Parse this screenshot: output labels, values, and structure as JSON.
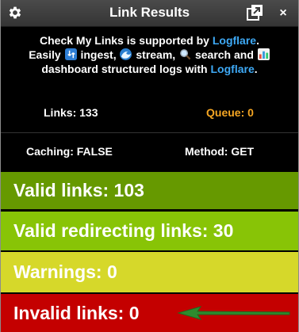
{
  "window": {
    "title": "Link Results",
    "settings_icon": "gear-icon",
    "popout_icon": "popout-icon",
    "close_label": "×"
  },
  "promo": {
    "line1_prefix": "Check My Links is supported by",
    "line1_link": "Logflare",
    "line1_suffix": ".",
    "easily": "Easily",
    "ingest": "ingest,",
    "stream": "stream,",
    "search": "search and",
    "dashboard": "dashboard structured logs with",
    "line3_link": "Logflare",
    "line3_suffix": ".",
    "emoji_icons": [
      "down-arrow-emoji-icon",
      "wave-emoji-icon",
      "magnifier-emoji-icon",
      "bar-chart-emoji-icon"
    ]
  },
  "stats": {
    "links": "Links: 133",
    "queue": "Queue: 0",
    "caching": "Caching: FALSE",
    "method": "Method: GET"
  },
  "results": {
    "valid": "Valid links: 103",
    "redirecting": "Valid redirecting links: 30",
    "warnings": "Warnings: 0",
    "invalid": "Invalid links: 0"
  },
  "colors": {
    "link": "#3ea9f5",
    "queue": "#f5a623",
    "valid": "#669900",
    "redirecting": "#88c406",
    "warnings": "#d6d82a",
    "invalid": "#c40000",
    "arrow": "#2e8b2e"
  }
}
